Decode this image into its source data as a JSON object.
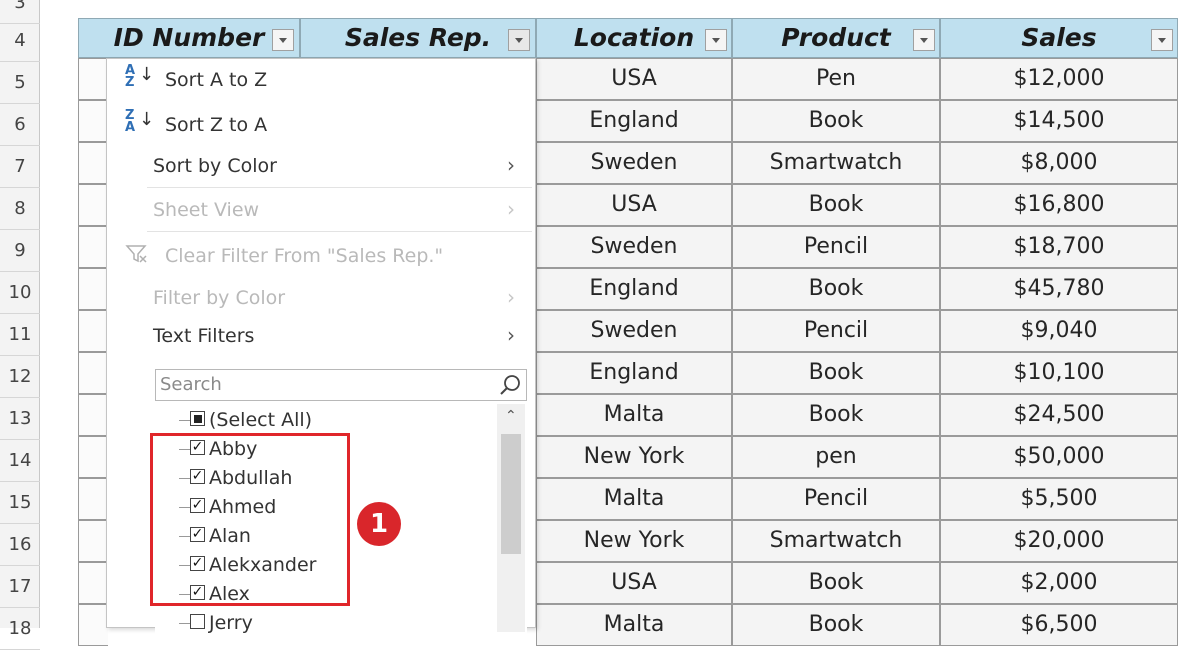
{
  "row_numbers": [
    "3",
    "4",
    "5",
    "6",
    "7",
    "8",
    "9",
    "10",
    "11",
    "12",
    "13",
    "14",
    "15",
    "16",
    "17",
    "18"
  ],
  "headers": [
    {
      "label": "ID Number"
    },
    {
      "label": "Sales Rep."
    },
    {
      "label": "Location"
    },
    {
      "label": "Product"
    },
    {
      "label": "Sales"
    }
  ],
  "rows": [
    {
      "location": "USA",
      "product": "Pen",
      "sales": "$12,000"
    },
    {
      "location": "England",
      "product": "Book",
      "sales": "$14,500"
    },
    {
      "location": "Sweden",
      "product": "Smartwatch",
      "sales": "$8,000"
    },
    {
      "location": "USA",
      "product": "Book",
      "sales": "$16,800"
    },
    {
      "location": "Sweden",
      "product": "Pencil",
      "sales": "$18,700"
    },
    {
      "location": "England",
      "product": "Book",
      "sales": "$45,780"
    },
    {
      "location": "Sweden",
      "product": "Pencil",
      "sales": "$9,040"
    },
    {
      "location": "England",
      "product": "Book",
      "sales": "$10,100"
    },
    {
      "location": "Malta",
      "product": "Book",
      "sales": "$24,500"
    },
    {
      "location": "New York",
      "product": "pen",
      "sales": "$50,000"
    },
    {
      "location": "Malta",
      "product": "Pencil",
      "sales": "$5,500"
    },
    {
      "location": "New York",
      "product": "Smartwatch",
      "sales": "$20,000"
    },
    {
      "location": "USA",
      "product": "Book",
      "sales": "$2,000"
    },
    {
      "location": "Malta",
      "product": "Book",
      "sales": "$6,500"
    }
  ],
  "menu": {
    "sort_az": "Sort A to Z",
    "sort_za": "Sort Z to A",
    "sort_by_color": "Sort by Color",
    "sheet_view": "Sheet View",
    "clear_filter": "Clear Filter From \"Sales Rep.\"",
    "filter_by_color": "Filter by Color",
    "text_filters": "Text Filters",
    "search_placeholder": "Search",
    "sort_az_icon": "A\nZ",
    "sort_za_icon": "Z\nA"
  },
  "filter_list": [
    {
      "label": "(Select All)",
      "state": "partial"
    },
    {
      "label": "Abby",
      "state": "checked"
    },
    {
      "label": "Abdullah",
      "state": "checked"
    },
    {
      "label": "Ahmed",
      "state": "checked"
    },
    {
      "label": "Alan",
      "state": "checked"
    },
    {
      "label": "Alekxander",
      "state": "checked"
    },
    {
      "label": "Alex",
      "state": "checked"
    },
    {
      "label": "Jerry",
      "state": "unchecked"
    }
  ],
  "annotation": {
    "badge": "1",
    "color": "#e0262a"
  },
  "colors": {
    "header_bg": "#bfe0ef",
    "cell_bg": "#f4f4f4"
  },
  "icons": [
    "filter-dropdown-icon",
    "sort-az-icon",
    "sort-za-icon",
    "clear-filter-icon",
    "search-icon",
    "chevron-right-icon",
    "scroll-up-icon"
  ]
}
